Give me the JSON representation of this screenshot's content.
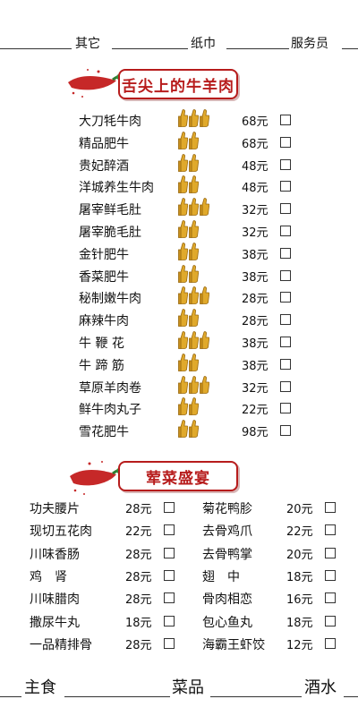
{
  "top_bar": {
    "other": "其它",
    "napkin": "纸巾",
    "waiter": "服务员"
  },
  "section_beef": {
    "title": "舌尖上的牛羊肉",
    "items": [
      {
        "name": "大刀牦牛肉",
        "price": "68元",
        "thumbs": 3
      },
      {
        "name": "精品肥牛",
        "price": "68元",
        "thumbs": 2
      },
      {
        "name": "贵妃醉酒",
        "price": "48元",
        "thumbs": 2
      },
      {
        "name": "洋城养生牛肉",
        "price": "48元",
        "thumbs": 2
      },
      {
        "name": "屠宰鲜毛肚",
        "price": "32元",
        "thumbs": 3
      },
      {
        "name": "屠宰脆毛肚",
        "price": "32元",
        "thumbs": 2
      },
      {
        "name": "金针肥牛",
        "price": "38元",
        "thumbs": 2
      },
      {
        "name": "香菜肥牛",
        "price": "38元",
        "thumbs": 2
      },
      {
        "name": "秘制嫩牛肉",
        "price": "28元",
        "thumbs": 3
      },
      {
        "name": "麻辣牛肉",
        "price": "28元",
        "thumbs": 2
      },
      {
        "name": "牛 鞭 花",
        "price": "38元",
        "thumbs": 3
      },
      {
        "name": "牛 蹄 筋",
        "price": "38元",
        "thumbs": 2
      },
      {
        "name": "草原羊肉卷",
        "price": "32元",
        "thumbs": 3
      },
      {
        "name": "鲜牛肉丸子",
        "price": "22元",
        "thumbs": 2
      },
      {
        "name": "雪花肥牛",
        "price": "98元",
        "thumbs": 2
      }
    ]
  },
  "section_veg": {
    "title": "荤菜盛宴",
    "rows": [
      {
        "left": {
          "name": "功夫腰片",
          "price": "28元"
        },
        "right": {
          "name": "菊花鸭胗",
          "price": "20元"
        }
      },
      {
        "left": {
          "name": "现切五花肉",
          "price": "22元"
        },
        "right": {
          "name": "去骨鸡爪",
          "price": "22元"
        }
      },
      {
        "left": {
          "name": "川味香肠",
          "price": "28元"
        },
        "right": {
          "name": "去骨鸭掌",
          "price": "20元"
        }
      },
      {
        "left": {
          "name": "鸡　肾",
          "price": "28元"
        },
        "right": {
          "name": "翅　中",
          "price": "18元"
        }
      },
      {
        "left": {
          "name": "川味腊肉",
          "price": "28元"
        },
        "right": {
          "name": "骨肉相恋",
          "price": "16元"
        }
      },
      {
        "left": {
          "name": "撒尿牛丸",
          "price": "18元"
        },
        "right": {
          "name": "包心鱼丸",
          "price": "18元"
        }
      },
      {
        "left": {
          "name": "一品精排骨",
          "price": "28元"
        },
        "right": {
          "name": "海霸王虾饺",
          "price": "12元"
        }
      }
    ]
  },
  "bottom_bar": {
    "staple": "主食",
    "dishes": "菜品",
    "drinks": "酒水"
  },
  "colors": {
    "accent_red": "#b71c1c",
    "thumb_gold": "#e0a92b"
  },
  "icons": {
    "chili": "chili-pepper-icon",
    "thumb": "thumbs-up-icon"
  }
}
